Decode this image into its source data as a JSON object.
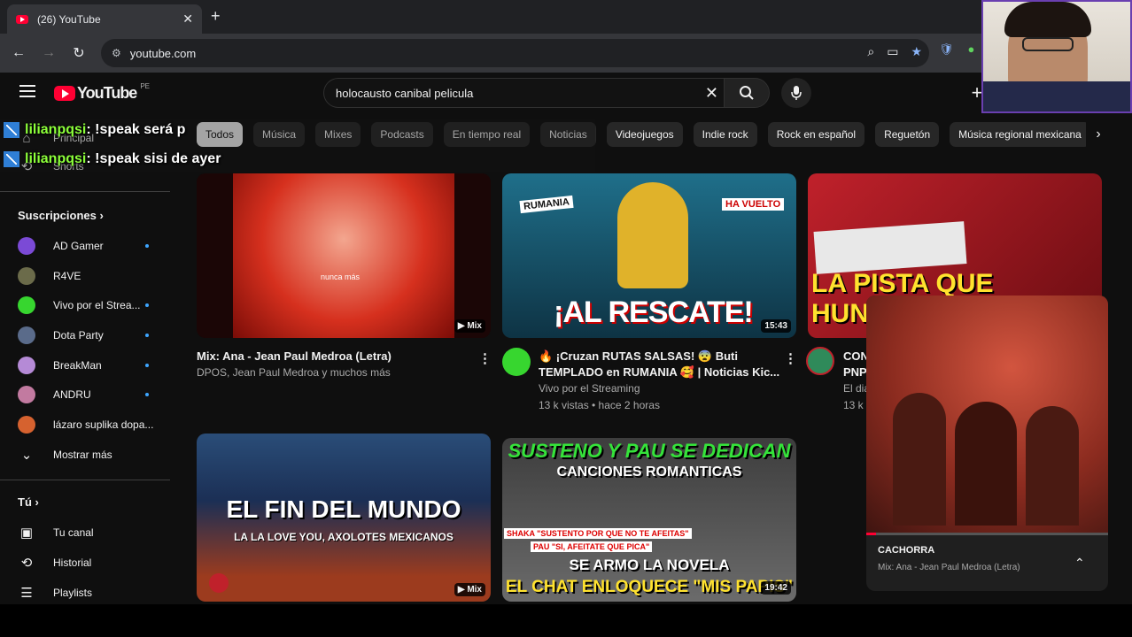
{
  "browser": {
    "tab_title": "(26) YouTube",
    "tab_close": "✕",
    "new_tab": "+",
    "url": "youtube.com"
  },
  "masthead": {
    "logo_text": "YouTube",
    "country_code": "PE",
    "search_query": "holocausto canibal pelicula"
  },
  "chips": [
    "Todos",
    "Música",
    "Mixes",
    "Podcasts",
    "En tiempo real",
    "Noticias",
    "Videojuegos",
    "Indie rock",
    "Rock en español",
    "Reguetón",
    "Música regional mexicana"
  ],
  "sidebar": {
    "top_items": [
      "Principal",
      "Shorts"
    ],
    "subs_header": "Suscripciones",
    "subscriptions": [
      {
        "name": "AD Gamer",
        "color": "#7b4ad6"
      },
      {
        "name": "R4VE",
        "color": "#6b6b4a"
      },
      {
        "name": "Vivo por el Strea...",
        "color": "#37d62f"
      },
      {
        "name": "Dota Party",
        "color": "#5a6b8a"
      },
      {
        "name": "BreakMan",
        "color": "#b58ad6"
      },
      {
        "name": "ANDRU",
        "color": "#c27aa0"
      },
      {
        "name": "lázaro suplika dopa...",
        "color": "#d6622f"
      }
    ],
    "show_more": "Mostrar más",
    "you_header": "Tú",
    "you_items": [
      {
        "label": "Tu canal",
        "icon": "channel-icon"
      },
      {
        "label": "Historial",
        "icon": "history-icon"
      },
      {
        "label": "Playlists",
        "icon": "playlists-icon"
      }
    ]
  },
  "chat": [
    {
      "user": "lilianpqsi",
      "text": " : !speak será p"
    },
    {
      "user": "lilianpqsi",
      "text": " : !speak sisi de ayer"
    }
  ],
  "videos": [
    {
      "title": "Mix: Ana - Jean Paul Medroa (Letra)",
      "channel": "DPOS, Jean Paul Medroa y muchos más",
      "badge": "Mix",
      "thumb_text": "nunca más"
    },
    {
      "title_line1": "🔥 ¡Cruzan RUTAS SALSAS! 😨 Buti",
      "title_line2": "TEMPLADO en RUMANIA 🥰 | Noticias Kic...",
      "channel": "Vivo por el Streaming",
      "meta": "13 k vistas • hace 2 horas",
      "badge": "15:43",
      "thumb_main": "¡AL RESCATE!",
      "thumb_left": "RUMANIA",
      "thumb_right": "HA VUELTO"
    },
    {
      "title_line1": "CON",
      "title_line2": "PNP",
      "channel": "El dia",
      "meta": "13 k",
      "thumb_main": "LA PISTA QUE",
      "thumb_sub": "HUNI"
    },
    {
      "badge": "Mix",
      "thumb_main": "EL FIN DEL MUNDO",
      "thumb_sub": "LA LA LOVE YOU, AXOLOTES MEXICANOS"
    },
    {
      "badge": "19:42",
      "thumb_top": "SUSTENO Y PAU SE DEDICAN",
      "thumb_top2": "CANCIONES ROMANTICAS",
      "thumb_quote1": "SHAKA \"SUSTENTO POR QUE NO TE AFEITAS\"",
      "thumb_quote2": "PAU \"SI, AFEITATE QUE PICA\"",
      "thumb_mid": "SE ARMO LA NOVELA",
      "thumb_bottom": "EL CHAT ENLOQUECE \"MIS PAPIS\""
    }
  ],
  "miniplayer": {
    "title": "CACHORRA",
    "subtitle": "Mix: Ana - Jean Paul Medroa (Letra)",
    "progress": 0.04
  },
  "colors": {
    "accent": "#ff0033",
    "chat_user": "#8cff3a",
    "badge_blue": "#3ea6ff"
  }
}
